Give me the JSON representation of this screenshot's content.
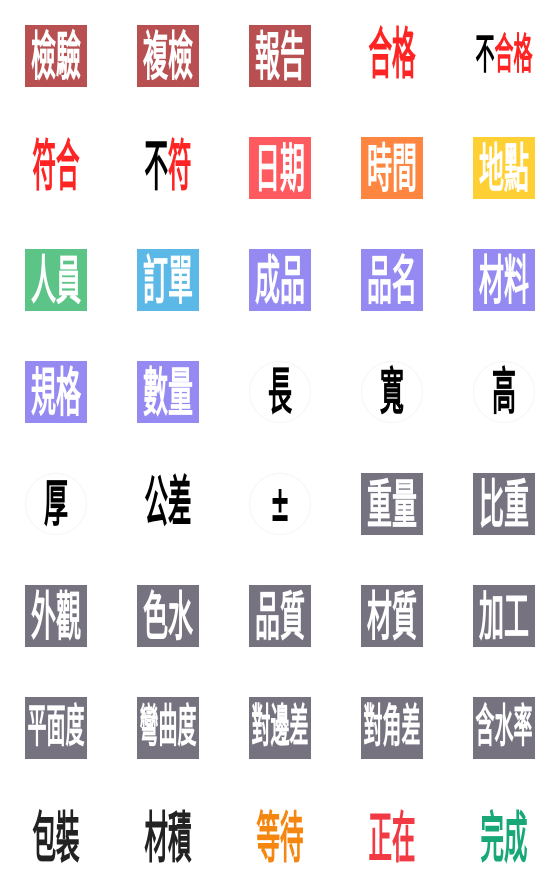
{
  "stickers": [
    {
      "kind": "box",
      "bg": "#B85052",
      "parts": [
        {
          "text": "檢驗",
          "color": "#FFFFFF"
        }
      ]
    },
    {
      "kind": "box",
      "bg": "#B85052",
      "parts": [
        {
          "text": "複檢",
          "color": "#FFFFFF"
        }
      ]
    },
    {
      "kind": "box",
      "bg": "#B85052",
      "parts": [
        {
          "text": "報告",
          "color": "#FFFFFF"
        }
      ]
    },
    {
      "kind": "plain",
      "bg": null,
      "parts": [
        {
          "text": "合格",
          "color": "#FF2424"
        }
      ]
    },
    {
      "kind": "plain",
      "bg": null,
      "parts": [
        {
          "text": "不",
          "color": "#000000"
        },
        {
          "text": "合格",
          "color": "#FF2424"
        }
      ]
    },
    {
      "kind": "plain",
      "bg": null,
      "parts": [
        {
          "text": "符合",
          "color": "#FF2424"
        }
      ]
    },
    {
      "kind": "plain",
      "bg": null,
      "parts": [
        {
          "text": "不",
          "color": "#000000"
        },
        {
          "text": "符",
          "color": "#FF2424"
        }
      ]
    },
    {
      "kind": "box",
      "bg": "#FF5A60",
      "parts": [
        {
          "text": "日期",
          "color": "#FFFFFF"
        }
      ]
    },
    {
      "kind": "box",
      "bg": "#FF8640",
      "parts": [
        {
          "text": "時間",
          "color": "#FFFFFF"
        }
      ]
    },
    {
      "kind": "box",
      "bg": "#FFD034",
      "parts": [
        {
          "text": "地點",
          "color": "#FFFFFF"
        }
      ]
    },
    {
      "kind": "box",
      "bg": "#5CC487",
      "parts": [
        {
          "text": "人員",
          "color": "#FFFFFF"
        }
      ]
    },
    {
      "kind": "box",
      "bg": "#5CB8E6",
      "parts": [
        {
          "text": "訂單",
          "color": "#FFFFFF"
        }
      ]
    },
    {
      "kind": "box",
      "bg": "#958AF2",
      "parts": [
        {
          "text": "成品",
          "color": "#FFFFFF"
        }
      ]
    },
    {
      "kind": "box",
      "bg": "#958AF2",
      "parts": [
        {
          "text": "品名",
          "color": "#FFFFFF"
        }
      ]
    },
    {
      "kind": "box",
      "bg": "#958AF2",
      "parts": [
        {
          "text": "材料",
          "color": "#FFFFFF"
        }
      ]
    },
    {
      "kind": "box",
      "bg": "#958AF2",
      "parts": [
        {
          "text": "規格",
          "color": "#FFFFFF"
        }
      ]
    },
    {
      "kind": "box",
      "bg": "#958AF2",
      "parts": [
        {
          "text": "數量",
          "color": "#FFFFFF"
        }
      ]
    },
    {
      "kind": "circle",
      "bg": "#FFFFFF",
      "parts": [
        {
          "text": "長",
          "color": "#000000"
        }
      ]
    },
    {
      "kind": "circle",
      "bg": "#FFFFFF",
      "parts": [
        {
          "text": "寬",
          "color": "#000000"
        }
      ]
    },
    {
      "kind": "circle",
      "bg": "#FFFFFF",
      "parts": [
        {
          "text": "高",
          "color": "#000000"
        }
      ]
    },
    {
      "kind": "circle",
      "bg": "#FFFFFF",
      "parts": [
        {
          "text": "厚",
          "color": "#000000"
        }
      ]
    },
    {
      "kind": "plain",
      "bg": null,
      "parts": [
        {
          "text": "公差",
          "color": "#000000"
        }
      ]
    },
    {
      "kind": "circle",
      "bg": "#FFFFFF",
      "parts": [
        {
          "text": "±",
          "color": "#000000"
        }
      ]
    },
    {
      "kind": "box",
      "bg": "#76727F",
      "parts": [
        {
          "text": "重量",
          "color": "#FFFFFF"
        }
      ]
    },
    {
      "kind": "box",
      "bg": "#76727F",
      "parts": [
        {
          "text": "比重",
          "color": "#FFFFFF"
        }
      ]
    },
    {
      "kind": "box",
      "bg": "#76727F",
      "parts": [
        {
          "text": "外觀",
          "color": "#FFFFFF"
        }
      ]
    },
    {
      "kind": "box",
      "bg": "#76727F",
      "parts": [
        {
          "text": "色水",
          "color": "#FFFFFF"
        }
      ]
    },
    {
      "kind": "box",
      "bg": "#76727F",
      "parts": [
        {
          "text": "品質",
          "color": "#FFFFFF"
        }
      ]
    },
    {
      "kind": "box",
      "bg": "#76727F",
      "parts": [
        {
          "text": "材質",
          "color": "#FFFFFF"
        }
      ]
    },
    {
      "kind": "box",
      "bg": "#76727F",
      "parts": [
        {
          "text": "加工",
          "color": "#FFFFFF"
        }
      ]
    },
    {
      "kind": "box",
      "bg": "#76727F",
      "parts": [
        {
          "text": "平面度",
          "color": "#FFFFFF"
        }
      ]
    },
    {
      "kind": "box",
      "bg": "#76727F",
      "parts": [
        {
          "text": "彎曲度",
          "color": "#FFFFFF"
        }
      ]
    },
    {
      "kind": "box",
      "bg": "#76727F",
      "parts": [
        {
          "text": "對邊差",
          "color": "#FFFFFF"
        }
      ]
    },
    {
      "kind": "box",
      "bg": "#76727F",
      "parts": [
        {
          "text": "對角差",
          "color": "#FFFFFF"
        }
      ]
    },
    {
      "kind": "box",
      "bg": "#76727F",
      "parts": [
        {
          "text": "含水率",
          "color": "#FFFFFF"
        }
      ]
    },
    {
      "kind": "plain",
      "bg": null,
      "parts": [
        {
          "text": "包裝",
          "color": "#222222"
        }
      ]
    },
    {
      "kind": "plain",
      "bg": null,
      "parts": [
        {
          "text": "材積",
          "color": "#222222"
        }
      ]
    },
    {
      "kind": "plain",
      "bg": null,
      "parts": [
        {
          "text": "等待",
          "color": "#F5860F"
        }
      ]
    },
    {
      "kind": "plain",
      "bg": null,
      "parts": [
        {
          "text": "正在",
          "color": "#F23A45"
        }
      ]
    },
    {
      "kind": "plain",
      "bg": null,
      "parts": [
        {
          "text": "完成",
          "color": "#18A878"
        }
      ]
    }
  ]
}
